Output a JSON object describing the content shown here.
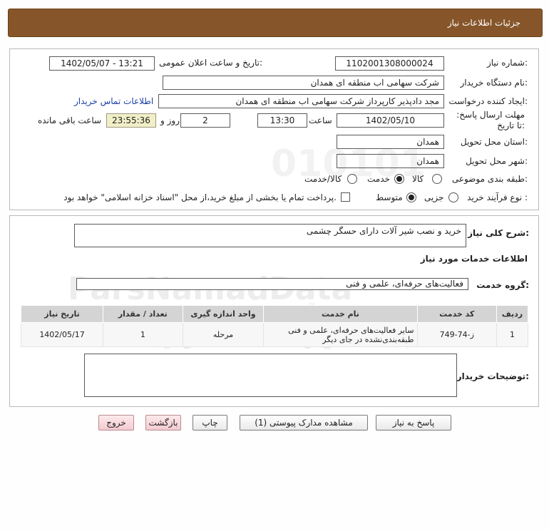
{
  "header": {
    "title": "جزئیات اطلاعات نیاز"
  },
  "form": {
    "need_number_label": "شماره نیاز:",
    "need_number": "1102001308000024",
    "announce_label": "تاریخ و ساعت اعلان عمومی:",
    "announce_value": "1402/05/07 - 13:21",
    "buyer_org_label": "نام دستگاه خریدار:",
    "buyer_org": "شرکت سهامی اب منطقه ای همدان",
    "creator_label": "ایجاد کننده درخواست:",
    "creator": "مجد دادپذیر کارپرداز شرکت سهامی اب منطقه ای همدان",
    "contact_link": "اطلاعات تماس خریدار",
    "deadline_label": "مهلت ارسال پاسخ: تا تاریخ:",
    "deadline_date": "1402/05/10",
    "time_label": "ساعت",
    "deadline_time": "13:30",
    "days_label": "روز و",
    "days_value": "2",
    "remaining_value": "23:55:36",
    "remaining_label": "ساعت باقی مانده",
    "province_label": "استان محل تحویل:",
    "province": "همدان",
    "city_label": "شهر محل تحویل:",
    "city": "همدان",
    "category_label": "طبقه بندی موضوعی:",
    "category_options": [
      "کالا",
      "خدمت",
      "کالا/خدمت"
    ],
    "category_selected": "خدمت",
    "process_label": "نوع فرآیند خرید :",
    "process_options": [
      "جزیی",
      "متوسط"
    ],
    "process_selected": "متوسط",
    "payment_note": "پرداخت تمام یا بخشی از مبلغ خرید،از محل \"اسناد خزانه اسلامی\" خواهد بود."
  },
  "description": {
    "label": "شرح کلی نیاز:",
    "value": "خرید و نصب شیر آلات دارای حسگر چشمی"
  },
  "services": {
    "section_title": "اطلاعات خدمات مورد نیاز",
    "group_label": "گروه خدمت:",
    "group_value": "فعالیت‌های حرفه‌ای، علمی و فنی",
    "columns": [
      "ردیف",
      "کد خدمت",
      "نام خدمت",
      "واحد اندازه گیری",
      "تعداد / مقدار",
      "تاریخ نیاز"
    ],
    "rows": [
      {
        "index": "1",
        "code": "ز-74-749",
        "name": "سایر فعالیت‌های حرفه‌ای، علمی و فنی طبقه‌بندی‌نشده در جای دیگر",
        "unit": "مرحله",
        "qty": "1",
        "date": "1402/05/17"
      }
    ]
  },
  "buyer_notes": {
    "label": "توضیحات خریدار:",
    "value": ""
  },
  "buttons": {
    "reply": "پاسخ به نیاز",
    "attachments": "مشاهده مدارک پیوستی (1)",
    "print": "چاپ",
    "back": "بازگشت",
    "exit": "خروج"
  },
  "watermark": {
    "digits": "010101",
    "brand": "ParsNamadData",
    "line1": "مرکز فن آوری اطلاعات پارس نماد داده",
    "line2": "پایگاه اطلاع رسانی مناقصه ومزایده",
    "phone": "۰۲۱-۸۸۳۴۹۶۷۰-۵"
  }
}
